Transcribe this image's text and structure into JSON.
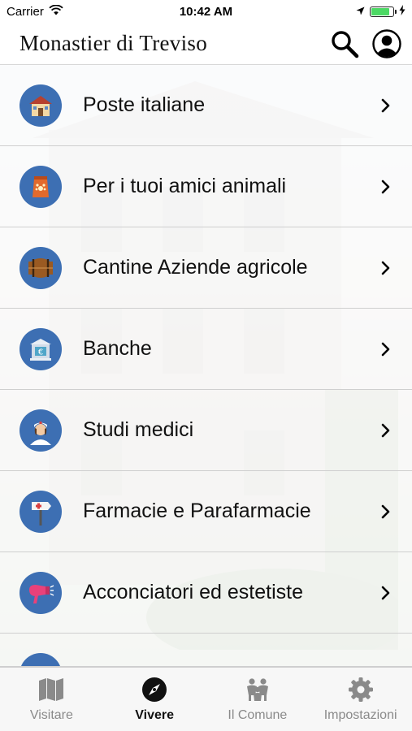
{
  "status_bar": {
    "carrier": "Carrier",
    "time": "10:42 AM",
    "battery_level": 0.85
  },
  "header": {
    "title": "Monastier di Treviso",
    "search_icon": "search-icon",
    "profile_icon": "user-icon"
  },
  "list": {
    "items": [
      {
        "label": "Poste italiane",
        "icon": "post-office-icon"
      },
      {
        "label": "Per i tuoi amici animali",
        "icon": "pet-food-icon"
      },
      {
        "label": "Cantine Aziende agricole",
        "icon": "barrel-icon"
      },
      {
        "label": "Banche",
        "icon": "bank-icon"
      },
      {
        "label": "Studi medici",
        "icon": "nurse-icon"
      },
      {
        "label": "Farmacie e Parafarmacie",
        "icon": "pharmacy-sign-icon"
      },
      {
        "label": "Acconciatori ed estetiste",
        "icon": "hairdryer-icon"
      }
    ]
  },
  "tabs": [
    {
      "label": "Visitare",
      "icon": "map-icon",
      "active": false
    },
    {
      "label": "Vivere",
      "icon": "compass-icon",
      "active": true
    },
    {
      "label": "Il Comune",
      "icon": "people-icon",
      "active": false
    },
    {
      "label": "Impostazioni",
      "icon": "gear-icon",
      "active": false
    }
  ],
  "colors": {
    "icon_circle": "#3d6fb3",
    "active_tab": "#111111",
    "inactive_tab": "#8a8a8a"
  }
}
